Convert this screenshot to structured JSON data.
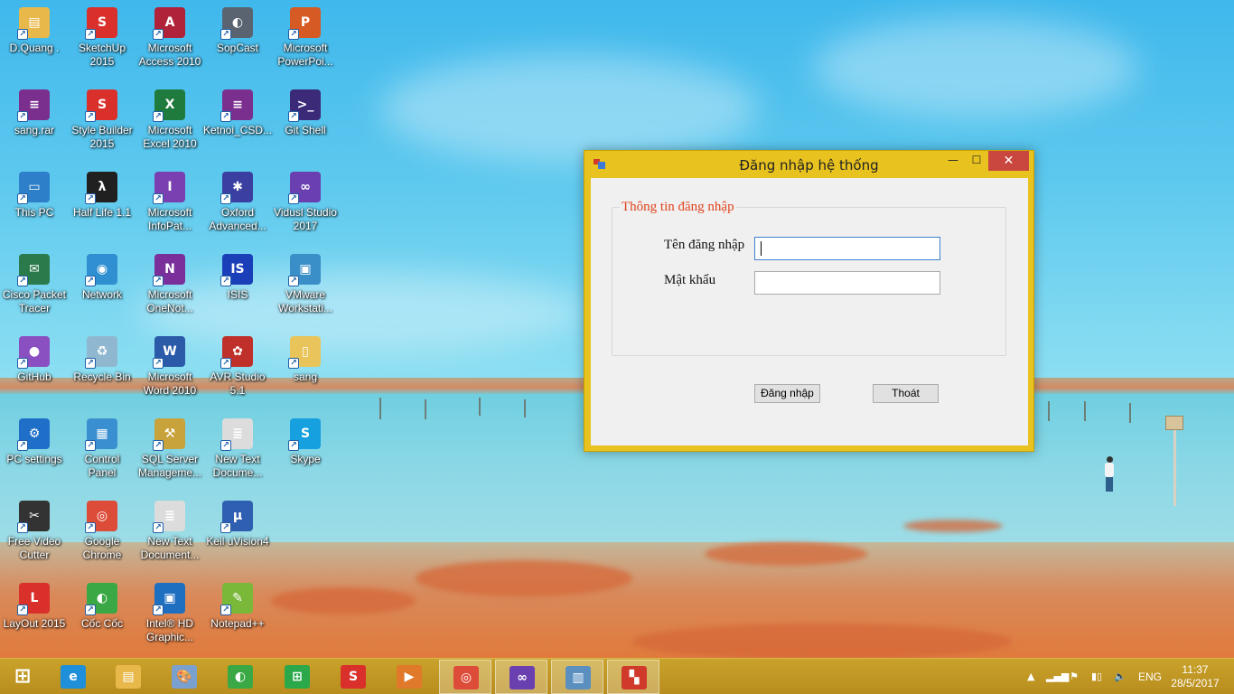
{
  "desktop": {
    "icons": [
      {
        "label": "D.Quang .",
        "icon": "user-folder-icon",
        "color": "#e8b84a",
        "glyph": "▤"
      },
      {
        "label": "SketchUp\n2015",
        "icon": "sketchup-icon",
        "color": "#d9302c",
        "glyph": "S"
      },
      {
        "label": "Microsoft\nAccess 2010",
        "icon": "access-icon",
        "color": "#b0223a",
        "glyph": "A"
      },
      {
        "label": "SopCast",
        "icon": "sopcast-icon",
        "color": "#5a6470",
        "glyph": "◐"
      },
      {
        "label": "Microsoft\nPowerPoi...",
        "icon": "powerpoint-icon",
        "color": "#d65a24",
        "glyph": "P"
      },
      {
        "label": "sang.rar",
        "icon": "winrar-icon",
        "color": "#7a2f8f",
        "glyph": "≡"
      },
      {
        "label": "Style Builder\n2015",
        "icon": "style-builder-icon",
        "color": "#d9302c",
        "glyph": "S"
      },
      {
        "label": "Microsoft\nExcel 2010",
        "icon": "excel-icon",
        "color": "#1f7a3d",
        "glyph": "X"
      },
      {
        "label": "Ketnoi_CSD...",
        "icon": "winrar-icon",
        "color": "#7a2f8f",
        "glyph": "≡"
      },
      {
        "label": "Git Shell",
        "icon": "git-shell-icon",
        "color": "#3b2a78",
        "glyph": ">_"
      },
      {
        "label": "This PC",
        "icon": "computer-icon",
        "color": "#2d7fc9",
        "glyph": "▭"
      },
      {
        "label": "Half Life 1.1",
        "icon": "half-life-icon",
        "color": "#202020",
        "glyph": "λ"
      },
      {
        "label": "Microsoft\nInfoPat...",
        "icon": "infopath-icon",
        "color": "#7a3fb0",
        "glyph": "I"
      },
      {
        "label": "Oxford\nAdvanced...",
        "icon": "oxford-dictionary-icon",
        "color": "#3b3fa0",
        "glyph": "✱"
      },
      {
        "label": "Vidusl Studio\n2017",
        "icon": "visual-studio-icon",
        "color": "#6a3fb0",
        "glyph": "∞"
      },
      {
        "label": "Cisco Packet\nTracer",
        "icon": "cisco-packet-tracer-icon",
        "color": "#2b7a4b",
        "glyph": "✉"
      },
      {
        "label": "Network",
        "icon": "network-icon",
        "color": "#2f8fd0",
        "glyph": "◉"
      },
      {
        "label": "Microsoft\nOneNot...",
        "icon": "onenote-icon",
        "color": "#7a2f9a",
        "glyph": "N"
      },
      {
        "label": "ISIS",
        "icon": "isis-icon",
        "color": "#1a3fb8",
        "glyph": "IS"
      },
      {
        "label": "VMware\nWorkstati...",
        "icon": "vmware-icon",
        "color": "#3a8fc8",
        "glyph": "▣"
      },
      {
        "label": "GitHub",
        "icon": "github-icon",
        "color": "#8a4fc0",
        "glyph": "●"
      },
      {
        "label": "Recycle Bin",
        "icon": "recycle-bin-icon",
        "color": "#8fb8d0",
        "glyph": "♻"
      },
      {
        "label": "Microsoft\nWord 2010",
        "icon": "word-icon",
        "color": "#2a5aa8",
        "glyph": "W"
      },
      {
        "label": "AVR Studio\n5.1",
        "icon": "avr-studio-icon",
        "color": "#c0302a",
        "glyph": "✿"
      },
      {
        "label": "sang",
        "icon": "folder-icon",
        "color": "#e8c45a",
        "glyph": "▯"
      },
      {
        "label": "PC settings",
        "icon": "gear-icon",
        "color": "#1f6fc8",
        "glyph": "⚙"
      },
      {
        "label": "Control\nPanel",
        "icon": "control-panel-icon",
        "color": "#3a8fd0",
        "glyph": "▦"
      },
      {
        "label": "SQL Server\nManageme...",
        "icon": "sql-server-icon",
        "color": "#c8a23a",
        "glyph": "⚒"
      },
      {
        "label": "New Text\nDocume...",
        "icon": "text-document-icon",
        "color": "#dcdcdc",
        "glyph": "≣"
      },
      {
        "label": "Skype",
        "icon": "skype-icon",
        "color": "#16a0e0",
        "glyph": "S"
      },
      {
        "label": "Free Video\nCutter",
        "icon": "video-cutter-icon",
        "color": "#333333",
        "glyph": "✂"
      },
      {
        "label": "Google\nChrome",
        "icon": "chrome-icon",
        "color": "#dd4b39",
        "glyph": "◎"
      },
      {
        "label": "New Text\nDocument...",
        "icon": "text-document-icon",
        "color": "#dcdcdc",
        "glyph": "≣"
      },
      {
        "label": "Keil uVision4",
        "icon": "keil-uvision-icon",
        "color": "#2f5fb0",
        "glyph": "μ"
      },
      {
        "label": "LayOut 2015",
        "icon": "layout-icon",
        "color": "#d9302c",
        "glyph": "L"
      },
      {
        "label": "Cốc Cốc",
        "icon": "coccoc-icon",
        "color": "#3aa845",
        "glyph": "◐"
      },
      {
        "label": "Intel® HD\nGraphic...",
        "icon": "intel-graphics-icon",
        "color": "#1f6fc0",
        "glyph": "▣"
      },
      {
        "label": "Notepad++",
        "icon": "notepad-plus-plus-icon",
        "color": "#7ab83a",
        "glyph": "✎"
      }
    ]
  },
  "dialog": {
    "title": "Đăng nhập hệ thống",
    "minimize": "—",
    "maximize": "☐",
    "close": "✕",
    "group_title": "Thông tin đăng nhập",
    "username_label": "Tên đăng nhập",
    "username_value": "",
    "password_label": "Mật khẩu",
    "password_value": "",
    "login_button": "Đăng nhập",
    "exit_button": "Thoát"
  },
  "taskbar": {
    "apps": [
      {
        "icon": "start-icon",
        "color": "#c9a22a",
        "glyph": "⊞",
        "active": false
      },
      {
        "icon": "internet-explorer-icon",
        "color": "#1e8fd8",
        "glyph": "e",
        "active": false
      },
      {
        "icon": "file-explorer-icon",
        "color": "#e8b84a",
        "glyph": "▤",
        "active": false
      },
      {
        "icon": "paint-icon",
        "color": "#7aa0d0",
        "glyph": "🎨",
        "active": false
      },
      {
        "icon": "coccoc-icon",
        "color": "#3aa845",
        "glyph": "◐",
        "active": false
      },
      {
        "icon": "store-icon",
        "color": "#2aa84a",
        "glyph": "⊞",
        "active": false
      },
      {
        "icon": "sketchup-icon",
        "color": "#d9302c",
        "glyph": "S",
        "active": false
      },
      {
        "icon": "media-player-icon",
        "color": "#e07a2a",
        "glyph": "▶",
        "active": false
      },
      {
        "icon": "chrome-icon",
        "color": "#dd4b39",
        "glyph": "◎",
        "active": true
      },
      {
        "icon": "visual-studio-icon",
        "color": "#6a3fb0",
        "glyph": "∞",
        "active": true
      },
      {
        "icon": "resource-monitor-icon",
        "color": "#5a8fc0",
        "glyph": "▥",
        "active": true
      },
      {
        "icon": "winforms-app-icon",
        "color": "#cf3a2a",
        "glyph": "▚",
        "active": true
      }
    ],
    "tray": {
      "language": "ENG",
      "time": "11:37",
      "date": "28/5/2017"
    }
  }
}
